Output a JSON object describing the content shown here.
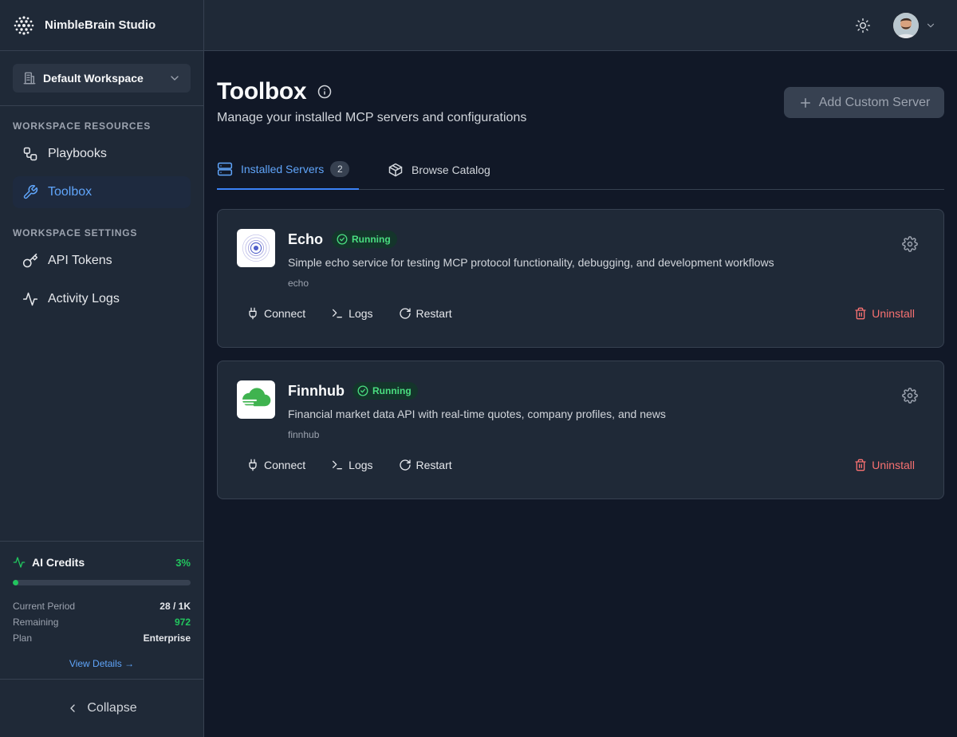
{
  "app": {
    "name": "NimbleBrain Studio"
  },
  "workspace": {
    "selected": "Default Workspace"
  },
  "sidebar": {
    "sections": [
      {
        "title": "WORKSPACE RESOURCES",
        "items": [
          {
            "label": "Playbooks"
          },
          {
            "label": "Toolbox",
            "active": true
          }
        ]
      },
      {
        "title": "WORKSPACE SETTINGS",
        "items": [
          {
            "label": "API Tokens"
          },
          {
            "label": "Activity Logs"
          }
        ]
      }
    ]
  },
  "credits": {
    "title": "AI Credits",
    "percent_label": "3%",
    "usage_fraction": 0.03,
    "rows": [
      {
        "label": "Current Period",
        "value": "28 / 1K"
      },
      {
        "label": "Remaining",
        "value": "972"
      },
      {
        "label": "Plan",
        "value": "Enterprise"
      }
    ],
    "view_details": "View Details →"
  },
  "collapse_label": "Collapse",
  "page": {
    "title": "Toolbox",
    "subtitle": "Manage your installed MCP servers and configurations",
    "add_button": "Add Custom Server"
  },
  "tabs": [
    {
      "label": "Installed Servers",
      "count": "2",
      "active": true
    },
    {
      "label": "Browse Catalog"
    }
  ],
  "servers": [
    {
      "name": "Echo",
      "status": "Running",
      "description": "Simple echo service for testing MCP protocol functionality, debugging, and development workflows",
      "slug": "echo",
      "icon": "echo-ripple-icon"
    },
    {
      "name": "Finnhub",
      "status": "Running",
      "description": "Financial market data API with real-time quotes, company profiles, and news",
      "slug": "finnhub",
      "icon": "finnhub-cloud-icon"
    }
  ],
  "card_actions": {
    "connect": "Connect",
    "logs": "Logs",
    "restart": "Restart",
    "uninstall": "Uninstall"
  },
  "colors": {
    "accent": "#60a5fa",
    "success": "#22c55e",
    "danger": "#f87171",
    "background": "#111827",
    "panel": "#1f2937"
  }
}
